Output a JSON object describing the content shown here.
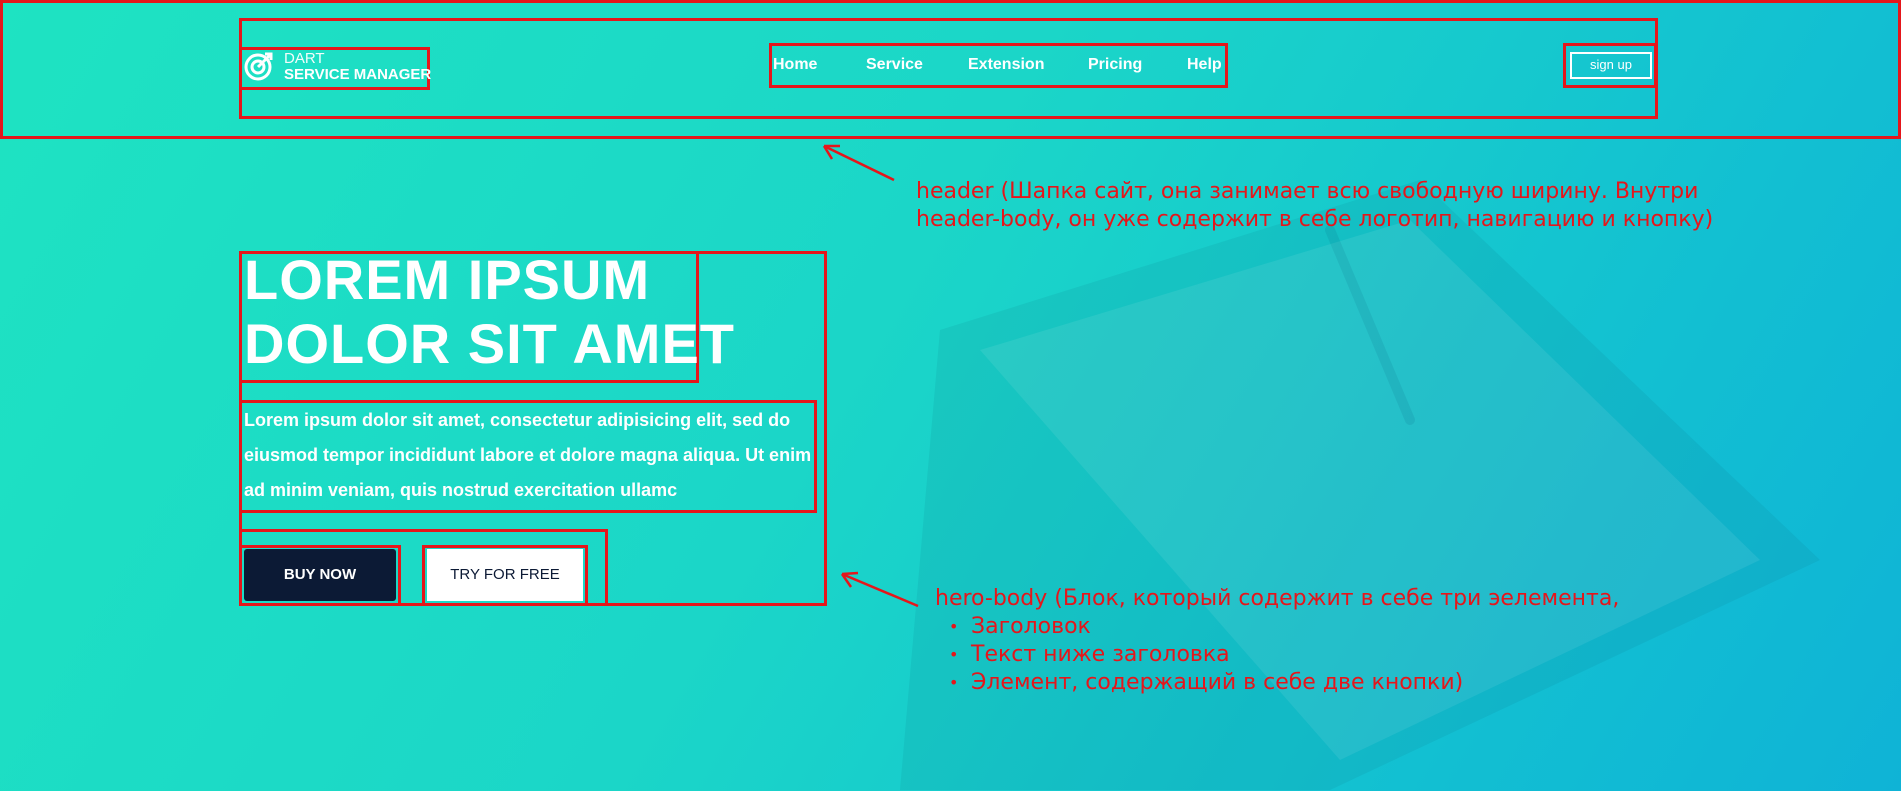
{
  "header": {
    "logo": {
      "line1": "DART",
      "line2": "SERVICE MANAGER",
      "icon": "target-icon"
    },
    "nav": [
      {
        "label": "Home"
      },
      {
        "label": "Service"
      },
      {
        "label": "Extension"
      },
      {
        "label": "Pricing"
      },
      {
        "label": "Help"
      }
    ],
    "signup_label": "sign up"
  },
  "hero": {
    "title_line1": "LOREM IPSUM",
    "title_line2": "DOLOR SIT AMET",
    "text_line1": "Lorem ipsum dolor sit amet, consectetur adipisicing elit, sed do",
    "text_line2": "eiusmod tempor incididunt labore et dolore magna aliqua. Ut enim",
    "text_line3": "ad minim veniam, quis nostrud exercitation ullamc",
    "buy_label": "BUY NOW",
    "try_label": "TRY FOR FREE"
  },
  "annotations": {
    "header_line1": "header (Шапка сайт, она занимает всю свободную ширину. Внутри",
    "header_line2": "header-body, он уже содержит в себе логотип, навигацию и кнопку)",
    "hero_line1": "hero-body (Блок, который содержит в себе три эелемента,",
    "hero_items": [
      "Заголовок",
      "Текст ниже заголовка",
      "Элемент, содержащий в себе две кнопки)"
    ]
  },
  "colors": {
    "accent_red": "#e5161b",
    "button_dark": "#0c1a35",
    "bg_start": "#1ee3c2",
    "bg_end": "#0fb3d6"
  }
}
